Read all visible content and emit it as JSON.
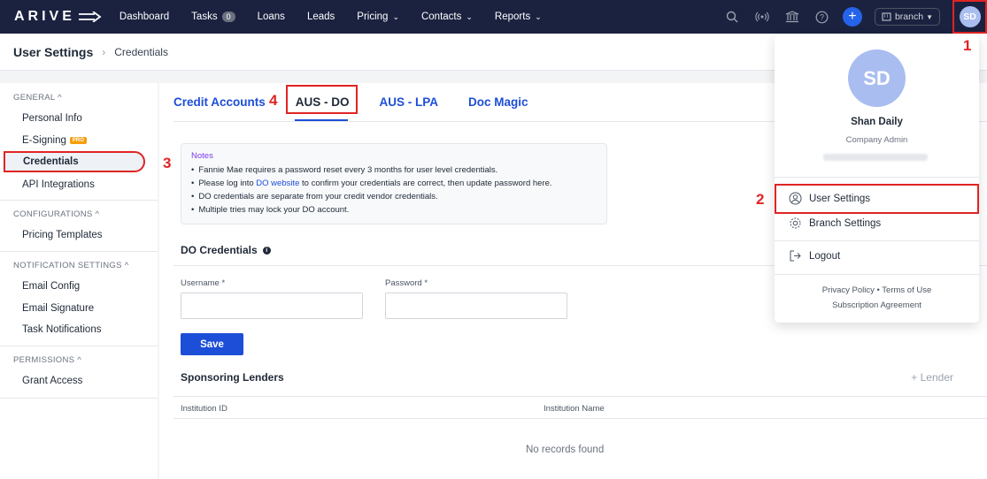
{
  "nav": {
    "logo": "ARIVE",
    "items": [
      {
        "label": "Dashboard"
      },
      {
        "label": "Tasks",
        "badge": "0"
      },
      {
        "label": "Loans"
      },
      {
        "label": "Leads"
      },
      {
        "label": "Pricing",
        "chevron": true
      },
      {
        "label": "Contacts",
        "chevron": true
      },
      {
        "label": "Reports",
        "chevron": true
      }
    ],
    "branch_label": "branch",
    "avatar_initials": "SD"
  },
  "breadcrumb": {
    "title": "User Settings",
    "current": "Credentials"
  },
  "sidebar": {
    "groups": [
      {
        "label": "GENERAL ^",
        "items": [
          "Personal Info",
          "E-Signing",
          "Credentials",
          "API Integrations"
        ]
      },
      {
        "label": "CONFIGURATIONS ^",
        "items": [
          "Pricing Templates"
        ]
      },
      {
        "label": "NOTIFICATION SETTINGS ^",
        "items": [
          "Email Config",
          "Email Signature",
          "Task Notifications"
        ]
      },
      {
        "label": "PERMISSIONS ^",
        "items": [
          "Grant Access"
        ]
      }
    ],
    "pro_badge": "PRO",
    "active": "Credentials"
  },
  "tabs": [
    "Credit Accounts",
    "AUS - DO",
    "AUS - LPA",
    "Doc Magic"
  ],
  "active_tab": "AUS - DO",
  "notes": {
    "title": "Notes",
    "items": [
      "Fannie Mae requires a password reset every 3 months for user level credentials.",
      "Please log into ",
      "DO credentials are separate from your credit vendor credentials.",
      "Multiple tries may lock your DO account."
    ],
    "link_text": "DO website",
    "link_suffix": " to confirm your credentials are correct, then update password here."
  },
  "do_credentials": {
    "title": "DO Credentials",
    "username_label": "Username *",
    "password_label": "Password *",
    "save_label": "Save"
  },
  "sponsoring": {
    "title": "Sponsoring Lenders",
    "add_label": "+ Lender",
    "columns": [
      "Institution ID",
      "Institution Name"
    ],
    "empty_text": "No records found"
  },
  "dropdown": {
    "initials": "SD",
    "name": "Shan Daily",
    "role": "Company Admin",
    "items": [
      "User Settings",
      "Branch Settings",
      "Logout"
    ],
    "footer_line1": "Privacy Policy • Terms of Use",
    "footer_line2": "Subscription Agreement"
  },
  "annotations": [
    "1",
    "2",
    "3",
    "4"
  ],
  "colors": {
    "nav_bg": "#1b2240",
    "accent": "#1d4ed8",
    "highlight": "#e02424"
  }
}
